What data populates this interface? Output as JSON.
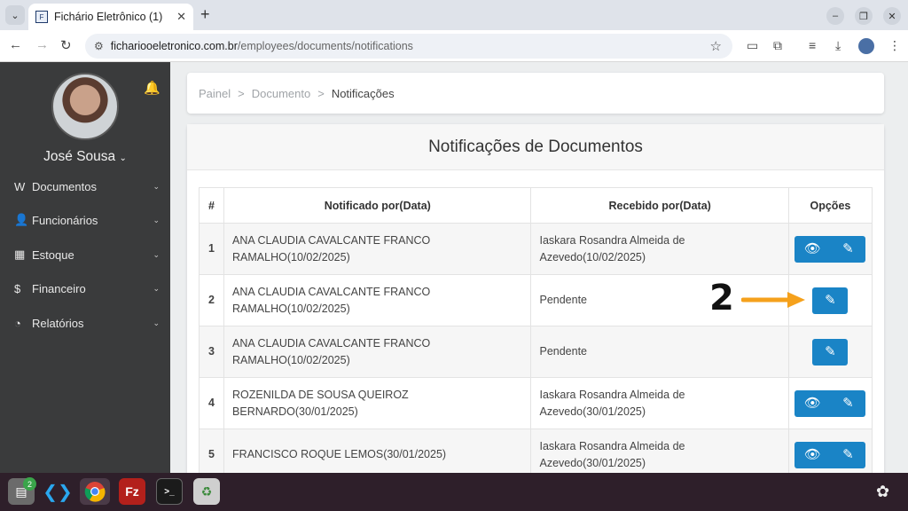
{
  "browser": {
    "tab_title": "Fichário Eletrônico (1)",
    "favicon": "F",
    "url_host": "fichariooeletronico.com.br",
    "url_path": "/employees/documents/notifications"
  },
  "sidebar": {
    "user_name": "José Sousa",
    "items": [
      {
        "label": "Documentos",
        "icon": "file-word-icon",
        "glyph": "W"
      },
      {
        "label": "Funcionários",
        "icon": "user-icon",
        "glyph": "👤"
      },
      {
        "label": "Estoque",
        "icon": "cubes-icon",
        "glyph": "▦"
      },
      {
        "label": "Financeiro",
        "icon": "dollar-icon",
        "glyph": "$"
      },
      {
        "label": "Relatórios",
        "icon": "pie-chart-icon",
        "glyph": "◔"
      }
    ]
  },
  "breadcrumb": [
    "Painel",
    "Documento",
    "Notificações"
  ],
  "page": {
    "title": "Notificações de Documentos"
  },
  "table": {
    "headers": [
      "#",
      "Notificado por(Data)",
      "Recebido por(Data)",
      "Opções"
    ],
    "rows": [
      {
        "num": "1",
        "notified": "ANA CLAUDIA CAVALCANTE FRANCO RAMALHO(10/02/2025)",
        "received": "Iaskara Rosandra Almeida de Azevedo(10/02/2025)",
        "has_view": true
      },
      {
        "num": "2",
        "notified": "ANA CLAUDIA CAVALCANTE FRANCO RAMALHO(10/02/2025)",
        "received": "Pendente",
        "has_view": false
      },
      {
        "num": "3",
        "notified": "ANA CLAUDIA CAVALCANTE FRANCO RAMALHO(10/02/2025)",
        "received": "Pendente",
        "has_view": false
      },
      {
        "num": "4",
        "notified": "ROZENILDA DE SOUSA QUEIROZ BERNARDO(30/01/2025)",
        "received": "Iaskara Rosandra Almeida de Azevedo(30/01/2025)",
        "has_view": true
      },
      {
        "num": "5",
        "notified": "FRANCISCO ROQUE LEMOS(30/01/2025)",
        "received": "Iaskara Rosandra Almeida de Azevedo(30/01/2025)",
        "has_view": true
      }
    ]
  },
  "annotation": {
    "label": "2",
    "color": "#f5a11c"
  },
  "taskbar": {
    "files_badge": "2"
  }
}
